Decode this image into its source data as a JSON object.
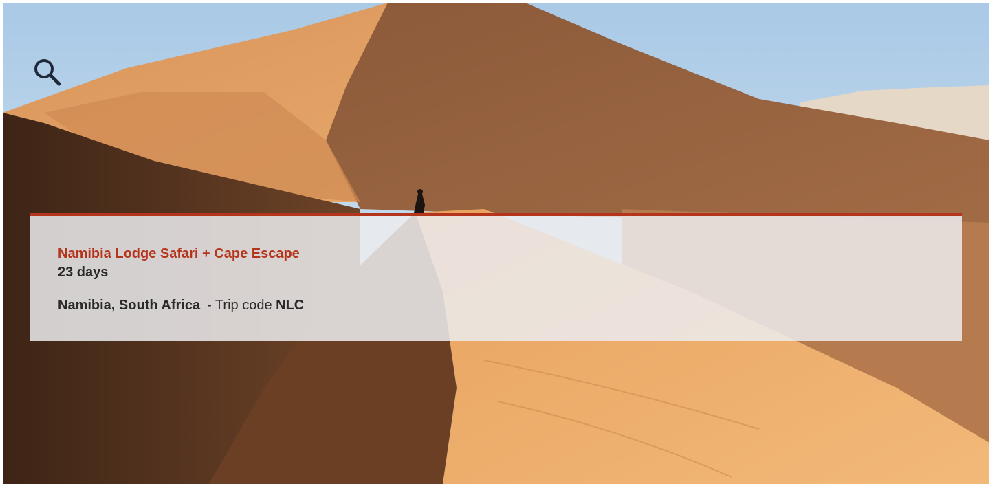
{
  "hero": {
    "image_alt": "Person walking along the crest of a red sand dune",
    "colors": {
      "sky": "#bcd4e8",
      "sand_light": "#e6a66b",
      "sand_dark": "#5a3520",
      "accent": "#b5341c"
    }
  },
  "search": {
    "icon": "search-icon"
  },
  "trip": {
    "title": "Namibia Lodge Safari + Cape Escape",
    "duration": "23 days",
    "countries": "Namibia, South Africa",
    "code_prefix": "- Trip code",
    "code": "NLC"
  }
}
